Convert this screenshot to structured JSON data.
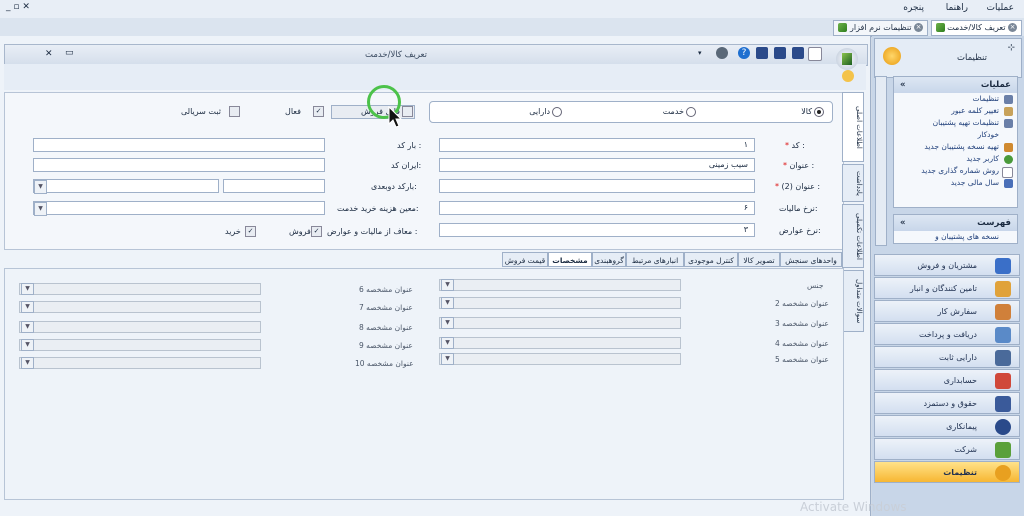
{
  "menubar": {
    "items": [
      "عملیات",
      "راهنما",
      "پنجره"
    ]
  },
  "doc_tabs": [
    {
      "label": "تعریف کالا/خدمت",
      "active": true
    },
    {
      "label": "تنظیمات نرم افزار",
      "active": false
    }
  ],
  "window": {
    "title": "تعریف کالا/خدمت"
  },
  "form": {
    "type_options": [
      {
        "label": "کالا",
        "selected": true
      },
      {
        "label": "خدمت",
        "selected": false
      },
      {
        "label": "دارایی",
        "selected": false
      }
    ],
    "checkbox_unsold": {
      "label": "قابل فروش"
    },
    "checkbox_active": {
      "label": "فعال"
    },
    "checkbox_serial": {
      "label": "ثبت سریالی"
    },
    "code": {
      "label": "کد :",
      "value": "۱"
    },
    "name": {
      "label": "عنوان :",
      "value": "سیب زمینی"
    },
    "name2": {
      "label": "عنوان (2) :",
      "value": ""
    },
    "tax_rate": {
      "label": "نرخ مالیات:",
      "value": "۶"
    },
    "duty_rate": {
      "label": "نرخ عوارض:",
      "value": "۳"
    },
    "barcode": {
      "label": "بار کد :",
      "value": ""
    },
    "iran_code": {
      "label": "ایران کد:",
      "value": ""
    },
    "barcode2": {
      "label": "بارکد دوبعدی:",
      "value": ""
    },
    "service_cost": {
      "label": "معین هزینه خرید خدمت:",
      "value": ""
    },
    "exempt": {
      "label": "معاف از مالیات و عوارض :",
      "sale": "فروش",
      "buy": "خرید"
    }
  },
  "vertical_tabs": [
    "اطلاعات اصلی",
    "یادداشت",
    "اطلاعات تکمیلی",
    "سوالات متداول"
  ],
  "sub_tabs": [
    "واحدهای سنجش",
    "تصویر کالا",
    "کنترل موجودی",
    "انبارهای مرتبط",
    "گروهبندی",
    "مشخصات",
    "قیمت فروش"
  ],
  "spec_fields": {
    "left": [
      "جنس",
      "عنوان مشخصه 6",
      "عنوان مشخصه 7",
      "عنوان مشخصه 8",
      "عنوان مشخصه 9",
      "عنوان مشخصه 10"
    ],
    "right": [
      "عنوان مشخصه 2",
      "عنوان مشخصه 3",
      "عنوان مشخصه 4",
      "عنوان مشخصه 5"
    ]
  },
  "sidebar": {
    "header": "تنظیمات",
    "operations": {
      "title": "عملیات",
      "items": [
        "تنظیمات",
        "تغییر کلمه عبور",
        "تنظیمات تهیه پشتیبان",
        "خودکار",
        "تهیه نسخه پشتیبان جدید",
        "کاربر جدید",
        "روش شماره گذاری جدید",
        "سال مالی جدید"
      ]
    },
    "list": {
      "title": "فهرست",
      "items": [
        "نسخه های پشتیبان و"
      ]
    },
    "nav": [
      "مشتریان و فروش",
      "تامین کنندگان و انبار",
      "سفارش کار",
      "دریافت و پرداخت",
      "دارایی ثابت",
      "حسابداری",
      "حقوق و دستمزد",
      "پیمانکاری",
      "شرکت",
      "تنظیمات"
    ],
    "nav_active": "تنظیمات"
  },
  "watermark": "Activate Windows",
  "colors": {
    "accent": "#f7b733",
    "ring": "#4cc24a"
  }
}
